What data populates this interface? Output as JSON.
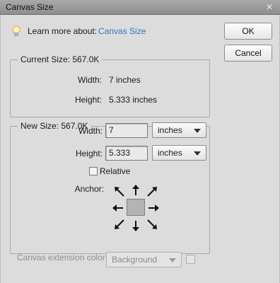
{
  "window": {
    "title": "Canvas Size"
  },
  "help": {
    "prefix": "Learn more about:",
    "link": "Canvas Size"
  },
  "buttons": {
    "ok": "OK",
    "cancel": "Cancel"
  },
  "current_size": {
    "legend": "Current Size: 567.0K",
    "width_label": "Width:",
    "width_value": "7 inches",
    "height_label": "Height:",
    "height_value": "5.333 inches"
  },
  "new_size": {
    "legend": "New Size: 567.0K",
    "width_label": "Width:",
    "width_value": "7",
    "width_unit": "inches",
    "height_label": "Height:",
    "height_value": "5.333",
    "height_unit": "inches",
    "relative_label": "Relative",
    "relative_checked": false,
    "anchor_label": "Anchor:"
  },
  "extension": {
    "label": "Canvas extension color:",
    "value": "Background",
    "enabled": false
  },
  "icons": {
    "close": "close-icon",
    "help": "lightbulb-icon",
    "anchor_arrows": [
      "arrow-up-left-icon",
      "arrow-up-icon",
      "arrow-up-right-icon",
      "arrow-left-icon",
      "arrow-right-icon",
      "arrow-down-left-icon",
      "arrow-down-icon",
      "arrow-down-right-icon"
    ]
  },
  "colors": {
    "link": "#2b78c6",
    "titlebar": "#9a9a9a",
    "dialog_bg": "#dcdcdc"
  }
}
